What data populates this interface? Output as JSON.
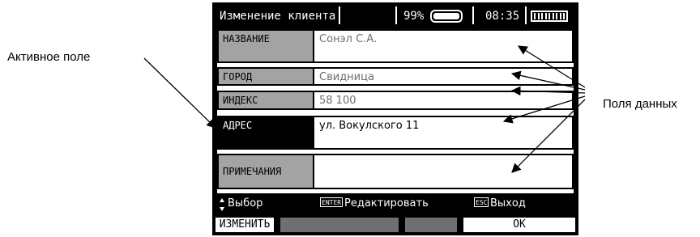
{
  "annotations": {
    "active_field": "Активное поле",
    "data_fields": "Поля данных"
  },
  "status_bar": {
    "title": "Изменение клиента",
    "battery_percent": "99%",
    "battery_level": 0.99,
    "time": "08:35",
    "signal_icon": "signal-strength-icon"
  },
  "fields": [
    {
      "label": "НАЗВАНИЕ",
      "value": "Сонэл С.А."
    },
    {
      "label": "ГОРОД",
      "value": "Свидница"
    },
    {
      "label": "ИНДЕКС",
      "value": "58 100"
    },
    {
      "label": "АДРЕС",
      "value": "ул. Вокулского 11"
    },
    {
      "label": "ПРИМЕЧАНИЯ",
      "value": ""
    }
  ],
  "help_bar": {
    "select": "Выбор",
    "enter_key": "ENTER",
    "edit": "Редактировать",
    "esc_key": "ESC",
    "exit": "Выход"
  },
  "softkeys": {
    "change": "ИЗМЕНИТЬ",
    "ok": "OK"
  },
  "colors": {
    "label_background": "#a3a3a3",
    "active_label_background": "#000000",
    "value_text": "#6d6d6d"
  }
}
